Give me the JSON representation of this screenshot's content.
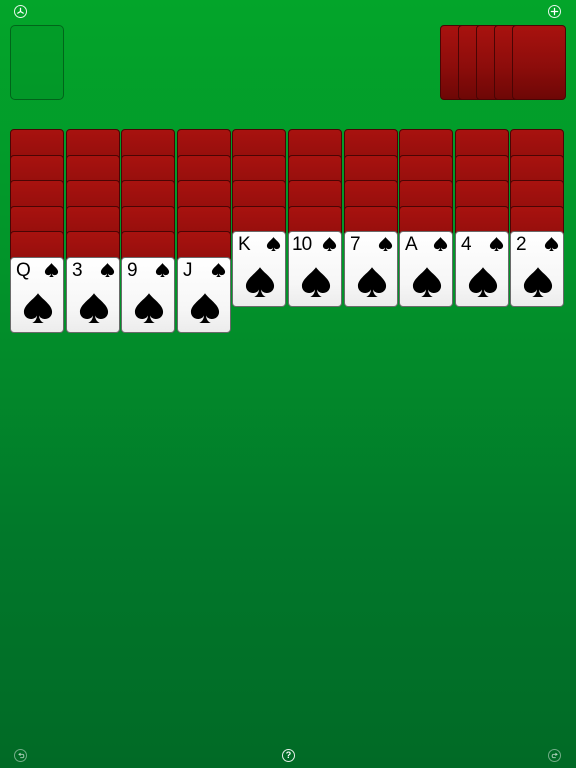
{
  "toolbar": {
    "settings_icon": "settings-dial-icon",
    "new_game_icon": "plus-icon",
    "undo_icon": "undo-icon",
    "help_icon": "question-icon",
    "help_label": "?",
    "redo_icon": "redo-icon"
  },
  "stock": {
    "remaining_deals": 5
  },
  "completed_foundations": 0,
  "colors": {
    "felt": "#029a2a",
    "card_back": "#8d0d0b",
    "card_face": "#ffffff",
    "suit": "#000000"
  },
  "tableau": [
    {
      "hidden": 5,
      "face_up": [
        {
          "rank": "Q",
          "suit": "spade"
        }
      ]
    },
    {
      "hidden": 5,
      "face_up": [
        {
          "rank": "3",
          "suit": "spade"
        }
      ]
    },
    {
      "hidden": 5,
      "face_up": [
        {
          "rank": "9",
          "suit": "spade"
        }
      ]
    },
    {
      "hidden": 5,
      "face_up": [
        {
          "rank": "J",
          "suit": "spade"
        }
      ]
    },
    {
      "hidden": 4,
      "face_up": [
        {
          "rank": "K",
          "suit": "spade"
        }
      ]
    },
    {
      "hidden": 4,
      "face_up": [
        {
          "rank": "10",
          "suit": "spade"
        }
      ]
    },
    {
      "hidden": 4,
      "face_up": [
        {
          "rank": "7",
          "suit": "spade"
        }
      ]
    },
    {
      "hidden": 4,
      "face_up": [
        {
          "rank": "A",
          "suit": "spade"
        }
      ]
    },
    {
      "hidden": 4,
      "face_up": [
        {
          "rank": "4",
          "suit": "spade"
        }
      ]
    },
    {
      "hidden": 4,
      "face_up": [
        {
          "rank": "2",
          "suit": "spade"
        }
      ]
    }
  ]
}
